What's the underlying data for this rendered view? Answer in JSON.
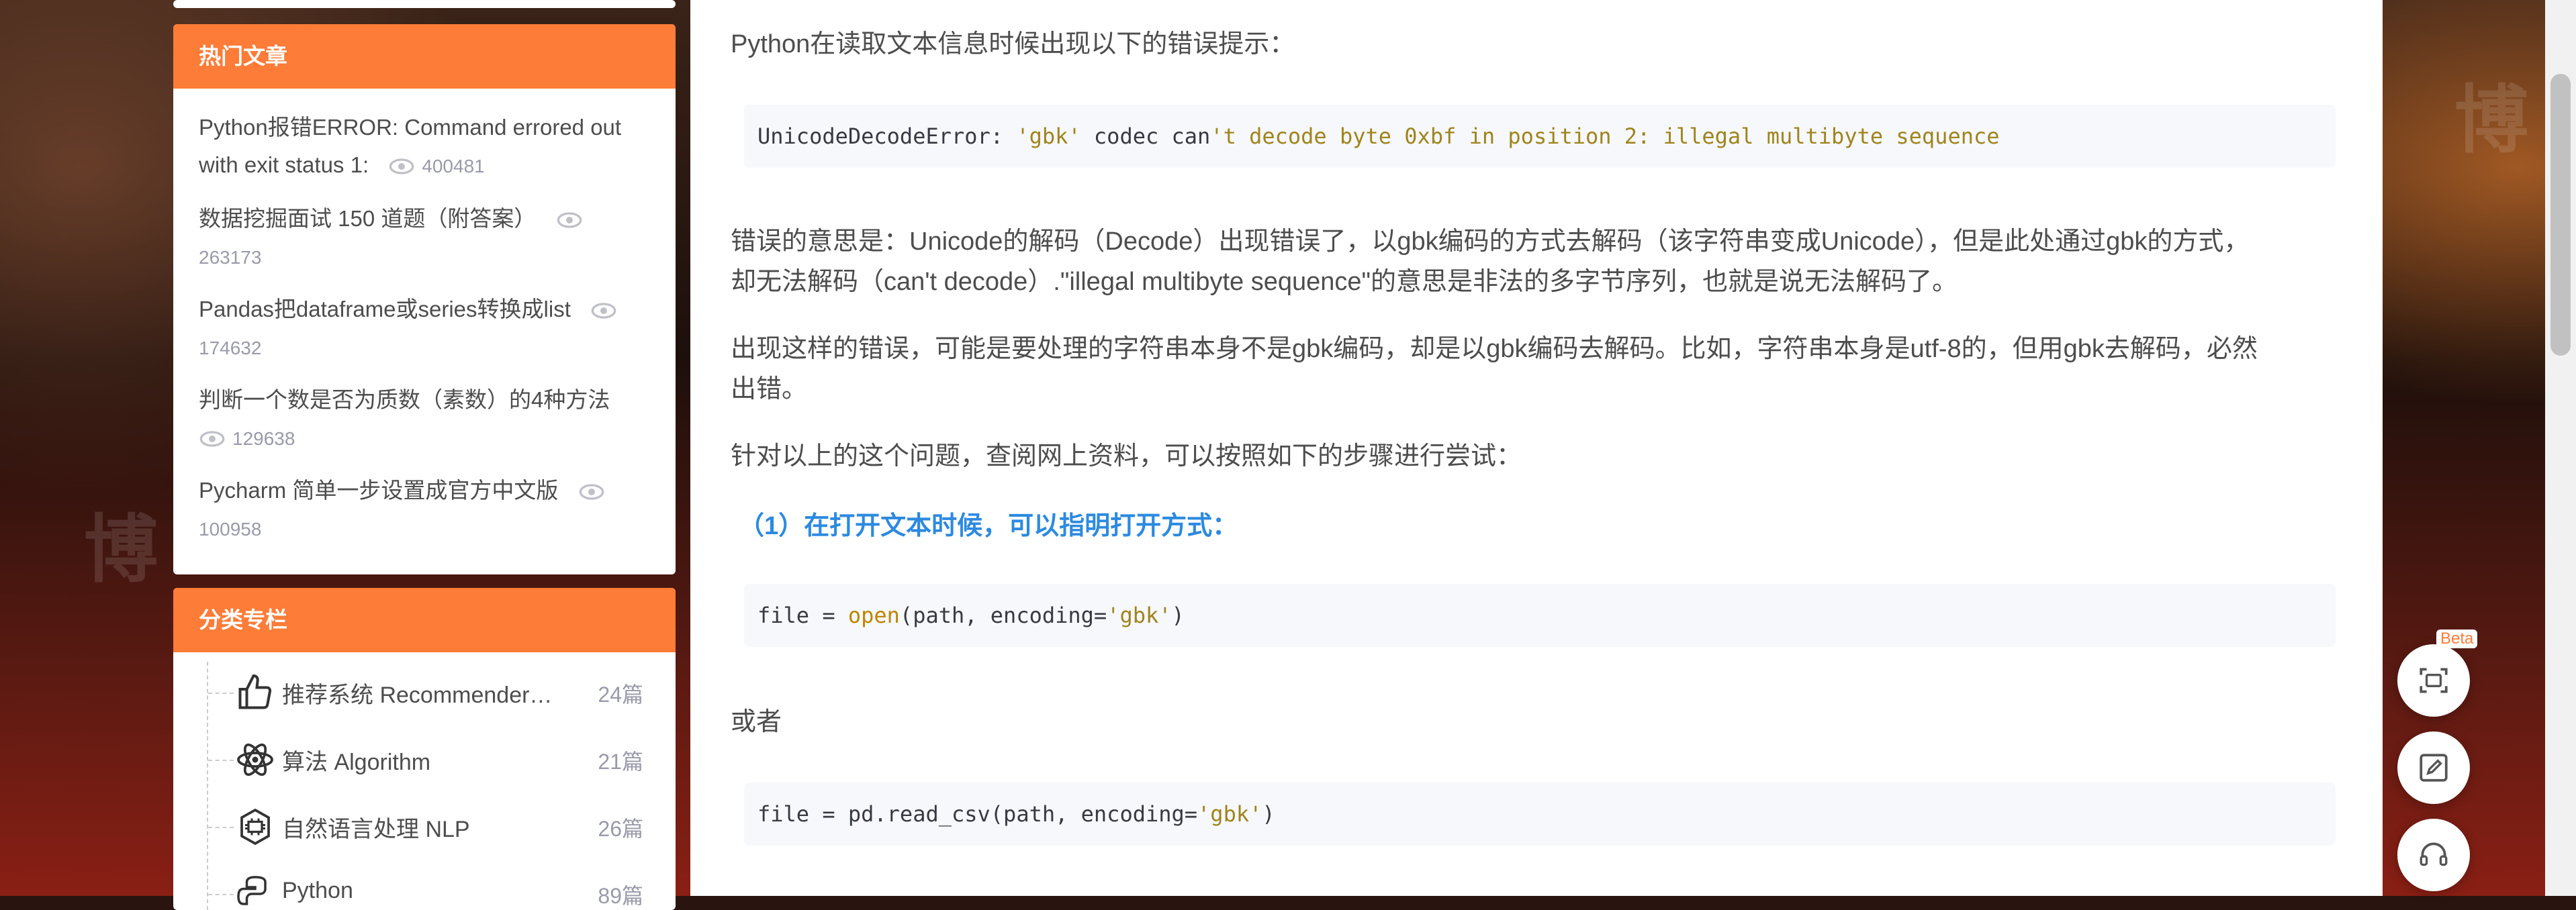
{
  "hot_articles": {
    "title": "热门文章",
    "items": [
      {
        "title": "Python报错ERROR: Command errored out with exit status 1:",
        "views": "400481"
      },
      {
        "title": "数据挖掘面试 150 道题（附答案）",
        "views": "263173"
      },
      {
        "title": "Pandas把dataframe或series转换成list",
        "views": "174632"
      },
      {
        "title": "判断一个数是否为质数（素数）的4种方法",
        "views": "129638"
      },
      {
        "title": "Pycharm 简单一步设置成官方中文版",
        "views": "100958"
      }
    ]
  },
  "categories": {
    "title": "分类专栏",
    "items": [
      {
        "name": "推荐系统 Recommender…",
        "count": "24篇",
        "icon": "thumbs-up-icon"
      },
      {
        "name": "算法 Algorithm",
        "count": "21篇",
        "icon": "atom-icon"
      },
      {
        "name": "自然语言处理 NLP",
        "count": "26篇",
        "icon": "chip-icon"
      },
      {
        "name": "Python",
        "count": "89篇",
        "icon": "python-icon"
      }
    ]
  },
  "article": {
    "p_intro": "Python在读取文本信息时候出现以下的错误提示：",
    "code1": {
      "a": "UnicodeDecodeError: ",
      "b": "'gbk'",
      "c": " codec can",
      "d": "'t decode byte 0xbf in position 2: illegal multibyte sequence"
    },
    "p_meaning_1": "错误的意思是：Unicode的解码（Decode）出现错误了，以gbk编码的方式去解码（该字符串变成Unicode），但是此处通过gbk的方式，",
    "p_meaning_2": "却无法解码（can't decode）.\"illegal multibyte sequence\"的意思是非法的多字节序列，也就是说无法解码了。",
    "p_cause_1": "出现这样的错误，可能是要处理的字符串本身不是gbk编码，却是以gbk编码去解码。比如，字符串本身是utf-8的，但用gbk去解码，必然",
    "p_cause_2": "出错。",
    "p_steps": "针对以上的这个问题，查阅网上资料，可以按照如下的步骤进行尝试：",
    "heading1": "（1）在打开文本时候，可以指明打开方式：",
    "code2": {
      "a": "file = ",
      "b": "open",
      "c": "(path, encoding=",
      "d": "'gbk'",
      "e": ")"
    },
    "p_or": "或者",
    "code3": {
      "a": "file = pd.read_csv(path, encoding=",
      "b": "'gbk'",
      "c": ")"
    }
  },
  "floaters": {
    "beta_label": "Beta"
  },
  "colors": {
    "accent": "#fc7c38",
    "heading": "#2c8ae0",
    "code_bg": "#f6f8fb"
  }
}
